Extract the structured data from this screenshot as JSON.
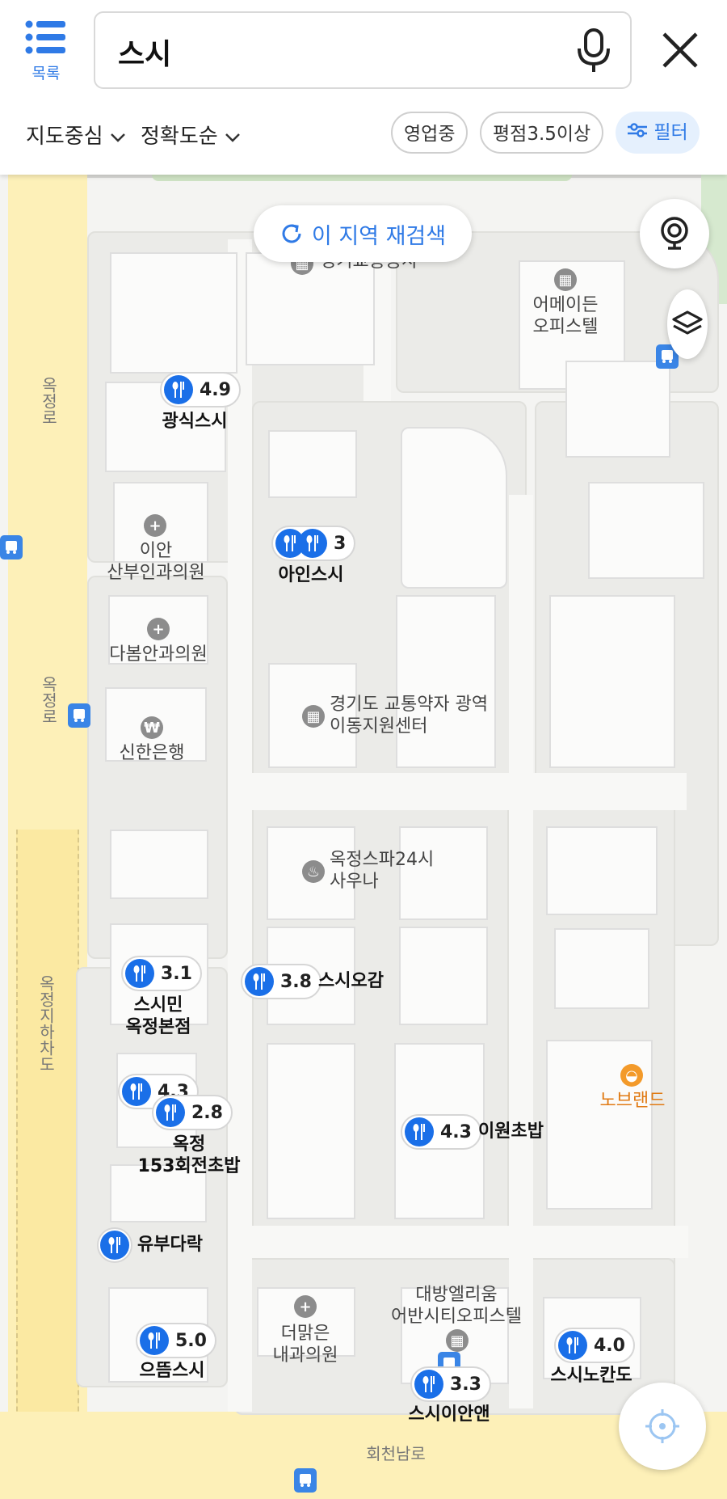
{
  "header": {
    "menu_label": "목록",
    "search_query": "스시",
    "sort_center": "지도중심",
    "sort_accuracy": "정확도순",
    "chip_open": "영업중",
    "chip_rating": "평점3.5이상",
    "chip_filter": "필터"
  },
  "map": {
    "research_label": "이 지역 재검색",
    "roads": {
      "okjeong_1": "옥정로",
      "okjeong_2": "옥정로",
      "underpass": "옥정지하차도",
      "hoecheon": "회천남로"
    },
    "places": {
      "gyeonggi_transport": "경기교통공사",
      "amade": "어메이든\n오피스텔",
      "ian_clinic": "이안\n산부인과의원",
      "dabom_clinic": "다봄안과의원",
      "shinhan": "신한은행",
      "mobility_center": "경기도 교통약자 광역\n이동지원센터",
      "spa": "옥정스파24시\n사우나",
      "nobrand": "노브랜드",
      "daebang": "대방엘리움\n어반시티오피스텔",
      "deomalgeun": "더맑은\n내과의원"
    },
    "restaurants": {
      "gwangsik": {
        "name": "광식스시",
        "rating": "4.9"
      },
      "ain": {
        "name": "아인스시",
        "rating": "3"
      },
      "smin": {
        "name": "스시민\n옥정본점",
        "rating": "3.1"
      },
      "sushiogam": {
        "name": "스시오감",
        "rating": "3.8"
      },
      "hoejeon_a": {
        "name": "",
        "rating": "4.3"
      },
      "hoejeon": {
        "name": "옥정\n153회전초밥",
        "rating": "2.8"
      },
      "iwon": {
        "name": "이원초밥",
        "rating": "4.3"
      },
      "yubu": {
        "name": "유부다락",
        "rating": ""
      },
      "eutteum": {
        "name": "으뜸스시",
        "rating": "5.0"
      },
      "nokando": {
        "name": "스시노칸도",
        "rating": "4.0"
      },
      "ian": {
        "name": "스시이안앤",
        "rating": "3.3"
      }
    }
  },
  "colors": {
    "accent": "#2f7ae6",
    "pin": "#1a6fe8",
    "road": "#fdf0b8",
    "nobrand": "#e07a13"
  }
}
